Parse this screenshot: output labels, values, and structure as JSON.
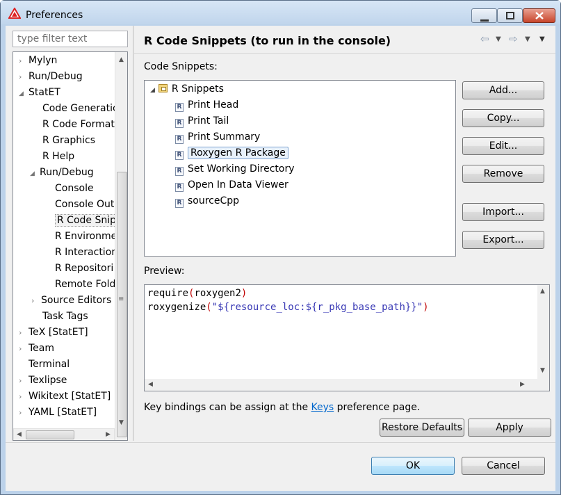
{
  "window": {
    "title": "Preferences"
  },
  "filter": {
    "placeholder": "type filter text"
  },
  "left_tree": [
    {
      "label": "Mylyn",
      "chev": "›"
    },
    {
      "label": "Run/Debug",
      "chev": "›"
    },
    {
      "label": "StatET",
      "chev": "◢"
    },
    {
      "label": "Code Generatic",
      "chev": ""
    },
    {
      "label": "R Code Formatt",
      "chev": ""
    },
    {
      "label": "R Graphics",
      "chev": ""
    },
    {
      "label": "R Help",
      "chev": ""
    },
    {
      "label": "Run/Debug",
      "chev": "◢"
    },
    {
      "label": "Console",
      "chev": ""
    },
    {
      "label": "Console Outp",
      "chev": ""
    },
    {
      "label": "R Code Snipp",
      "chev": ""
    },
    {
      "label": "R Environme",
      "chev": ""
    },
    {
      "label": "R Interaction",
      "chev": ""
    },
    {
      "label": "R Repositori",
      "chev": ""
    },
    {
      "label": "Remote Fold",
      "chev": ""
    },
    {
      "label": "Source Editors",
      "chev": "›"
    },
    {
      "label": "Task Tags",
      "chev": ""
    },
    {
      "label": "TeX  [StatET]",
      "chev": "›"
    },
    {
      "label": "Team",
      "chev": "›"
    },
    {
      "label": "Terminal",
      "chev": ""
    },
    {
      "label": "Texlipse",
      "chev": "›"
    },
    {
      "label": "Wikitext  [StatET]",
      "chev": "›"
    },
    {
      "label": "YAML  [StatET]",
      "chev": "›"
    }
  ],
  "page": {
    "title": "R Code Snippets (to run in the console)",
    "snippets_label": "Code Snippets:",
    "root": "R Snippets",
    "snippets": [
      "Print Head",
      "Print Tail",
      "Print Summary",
      "Roxygen R Package",
      "Set Working Directory",
      "Open In Data Viewer",
      "sourceCpp"
    ],
    "buttons": {
      "add": "Add...",
      "copy": "Copy...",
      "edit": "Edit...",
      "remove": "Remove",
      "import": "Import...",
      "export": "Export..."
    },
    "preview_label": "Preview:",
    "code": {
      "l1_fn": "require",
      "l1_open": "(",
      "l1_arg": "roxygen2",
      "l1_close": ")",
      "l2_fn": "roxygenize",
      "l2_open": "(",
      "l2_str": "\"${resource_loc:${r_pkg_base_path}}\"",
      "l2_close": ")"
    },
    "keys_pre": "Key bindings can be assign at the ",
    "keys_link": "Keys",
    "keys_post": " preference page.",
    "restore": "Restore Defaults",
    "apply": "Apply"
  },
  "dialog": {
    "ok": "OK",
    "cancel": "Cancel"
  },
  "icons": {
    "nav_back": "back-arrow-icon",
    "nav_forward": "forward-arrow-icon",
    "menu": "view-menu-icon"
  }
}
